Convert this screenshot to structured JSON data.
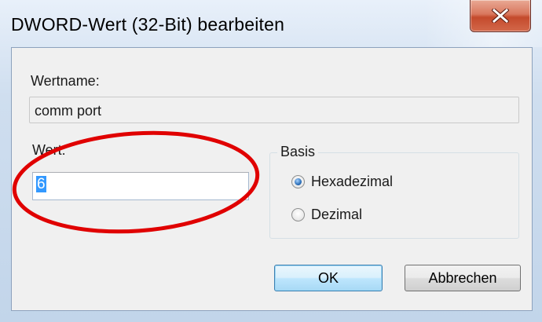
{
  "window": {
    "title": "DWORD-Wert (32-Bit) bearbeiten",
    "close_glyph": "X"
  },
  "fields": {
    "name_label": "Wertname:",
    "name_value": "comm port",
    "value_label": "Wert:",
    "value_value": "6"
  },
  "base": {
    "group_label": "Basis",
    "options": [
      {
        "label": "Hexadezimal",
        "checked": true
      },
      {
        "label": "Dezimal",
        "checked": false
      }
    ]
  },
  "buttons": {
    "ok_label": "OK",
    "cancel_label": "Abbrechen"
  },
  "colors": {
    "annotation": "#e00000",
    "selection": "#3399ff",
    "close_button": "#c44a2c"
  },
  "icons": {
    "close": "close-icon"
  }
}
